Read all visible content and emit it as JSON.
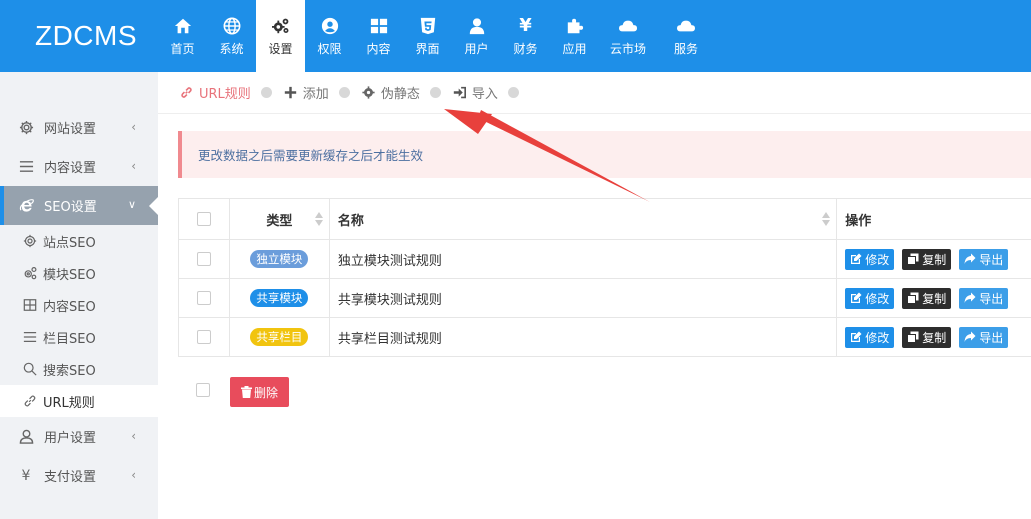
{
  "app": {
    "logo": "ZDCMS"
  },
  "nav": [
    {
      "label": "首页",
      "icon": "home-icon"
    },
    {
      "label": "系统",
      "icon": "globe-icon"
    },
    {
      "label": "设置",
      "icon": "gears-icon"
    },
    {
      "label": "权限",
      "icon": "user-circle-icon"
    },
    {
      "label": "内容",
      "icon": "grid-icon"
    },
    {
      "label": "界面",
      "icon": "html5-icon"
    },
    {
      "label": "用户",
      "icon": "user-icon"
    },
    {
      "label": "财务",
      "icon": "yen-icon"
    },
    {
      "label": "应用",
      "icon": "puzzle-icon"
    },
    {
      "label": "云市场",
      "icon": "cloud-icon"
    },
    {
      "label": "服务",
      "icon": "cloud-icon"
    }
  ],
  "sidebar": {
    "items": [
      {
        "label": "网站设置",
        "icon": "gear-icon"
      },
      {
        "label": "内容设置",
        "icon": "list-icon"
      },
      {
        "label": "SEO设置",
        "icon": "ie-icon"
      },
      {
        "label": "用户设置",
        "icon": "user-icon"
      },
      {
        "label": "支付设置",
        "icon": "yen-icon"
      }
    ],
    "sub_items": [
      {
        "label": "站点SEO",
        "icon": "gear-icon"
      },
      {
        "label": "模块SEO",
        "icon": "gears-icon"
      },
      {
        "label": "内容SEO",
        "icon": "table-icon"
      },
      {
        "label": "栏目SEO",
        "icon": "list-icon"
      },
      {
        "label": "搜索SEO",
        "icon": "search-icon"
      },
      {
        "label": "URL规则",
        "icon": "link-icon"
      }
    ],
    "caret": "‹"
  },
  "tabs": [
    {
      "label": "URL规则",
      "icon": "link-icon"
    },
    {
      "label": "添加",
      "icon": "plus-icon"
    },
    {
      "label": "伪静态",
      "icon": "gear-icon"
    },
    {
      "label": "导入",
      "icon": "sign-in-icon"
    }
  ],
  "alert": {
    "text": "更改数据之后需要更新缓存之后才能生效"
  },
  "table": {
    "headers": {
      "type": "类型",
      "name": "名称",
      "ops": "操作"
    },
    "rows": [
      {
        "type": "独立模块",
        "type_color": "#6b9ddb",
        "name": "独立模块测试规则"
      },
      {
        "type": "共享模块",
        "type_color": "#1e8fe8",
        "name": "共享模块测试规则"
      },
      {
        "type": "共享栏目",
        "type_color": "#f1c40f",
        "name": "共享栏目测试规则"
      }
    ],
    "actions": {
      "edit": "修改",
      "copy": "复制",
      "export": "导出"
    }
  },
  "footer": {
    "delete_label": "删除"
  },
  "colors": {
    "primary": "#1e8fe8",
    "danger": "#e84c5c",
    "alert_bg": "#fdeeee",
    "arrow": "#e8403c"
  }
}
